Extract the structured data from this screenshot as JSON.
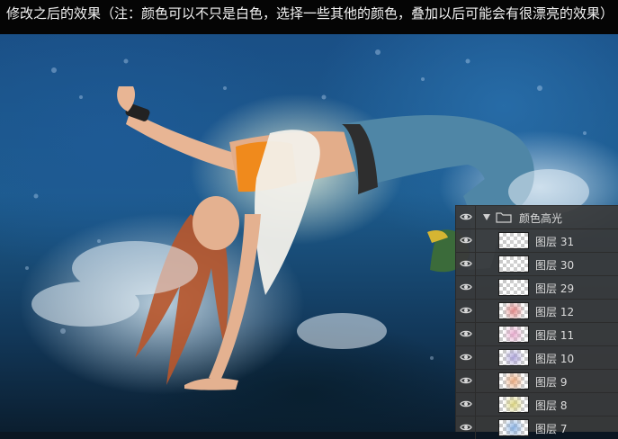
{
  "caption": "修改之后的效果（注：颜色可以不只是白色，选择一些其他的颜色，叠加以后可能会有很漂亮的效果）",
  "layers_panel": {
    "group": {
      "name": "颜色高光",
      "expanded": true,
      "visible": true
    },
    "layers": [
      {
        "name": "图层 31",
        "visible": true,
        "thumb_tint": "#ffffff"
      },
      {
        "name": "图层 30",
        "visible": true,
        "thumb_tint": "#ffffff"
      },
      {
        "name": "图层 29",
        "visible": true,
        "thumb_tint": "#ffffff"
      },
      {
        "name": "图层 12",
        "visible": true,
        "thumb_tint": "#e07a7a"
      },
      {
        "name": "图层 11",
        "visible": true,
        "thumb_tint": "#e6a0c8"
      },
      {
        "name": "图层 10",
        "visible": true,
        "thumb_tint": "#a49ad6"
      },
      {
        "name": "图层 9",
        "visible": true,
        "thumb_tint": "#e8a070"
      },
      {
        "name": "图层 8",
        "visible": true,
        "thumb_tint": "#d8d070"
      },
      {
        "name": "图层 7",
        "visible": true,
        "thumb_tint": "#7aa8e0"
      }
    ]
  },
  "colors": {
    "panel_bg": "#3a3a3a",
    "caption_bg": "#050505",
    "caption_text": "#f2f2f2"
  }
}
